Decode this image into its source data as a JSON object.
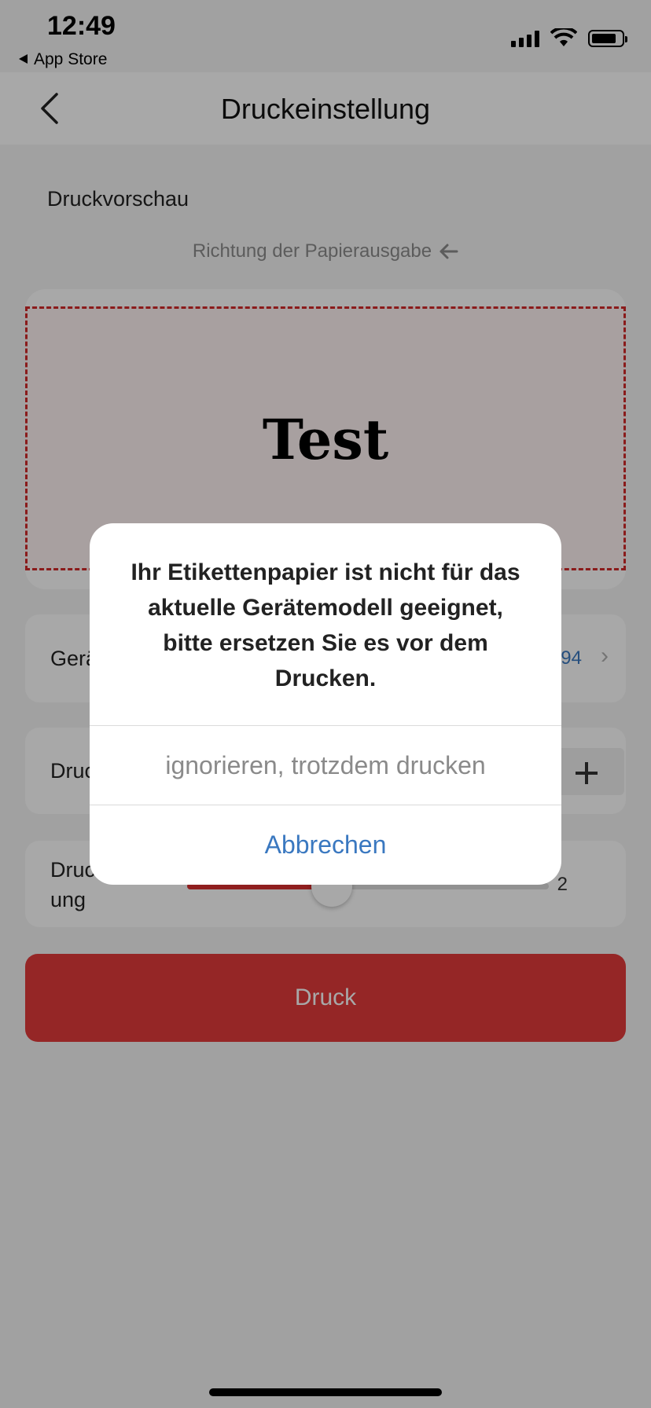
{
  "status_bar": {
    "time": "12:49",
    "back_app": "App Store"
  },
  "nav": {
    "title": "Druckeinstellung"
  },
  "preview": {
    "section_label": "Druckvorschau",
    "direction_label": "Richtung der Papierausgabe",
    "label_text": "Test"
  },
  "rows": {
    "device_label": "Gerä",
    "device_value": "94",
    "copies_label": "Druc",
    "density_label_line1": "Druc",
    "density_label_line2": "ung",
    "density_max": "2",
    "density_fraction": 0.4
  },
  "print_button": {
    "label": "Druck"
  },
  "dialog": {
    "message": "Ihr Etikettenpapier ist nicht für das aktuelle Gerätemodell geeignet, bitte ersetzen Sie es vor dem Drucken.",
    "ignore_label": "ignorieren, trotzdem drucken",
    "cancel_label": "Abbrechen"
  },
  "colors": {
    "accent": "#e33b3b",
    "link": "#3a78c0",
    "overlay": "rgba(0,0,0,0.34)"
  }
}
